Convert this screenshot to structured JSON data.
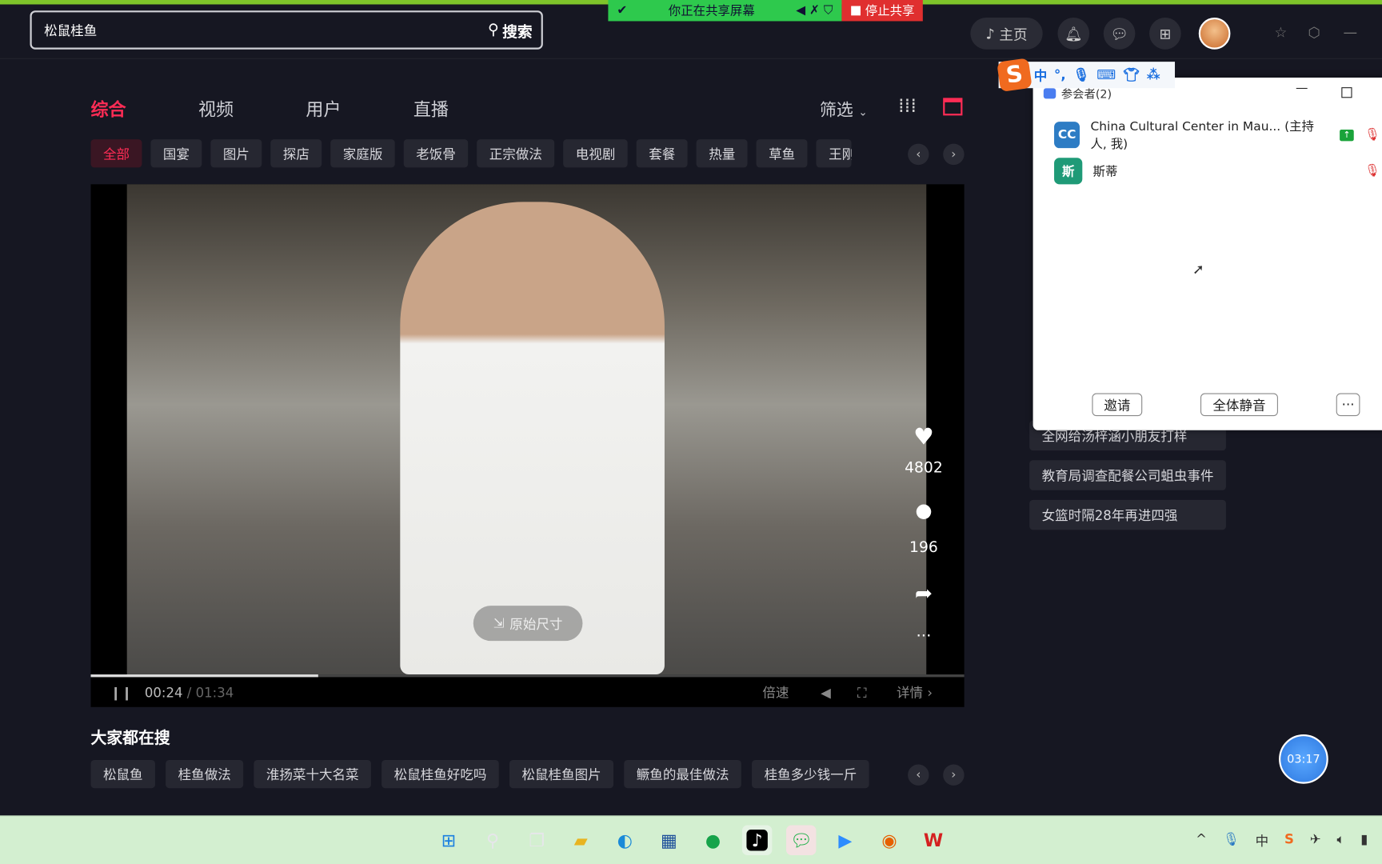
{
  "search": {
    "value": "松鼠桂鱼",
    "button": "搜索"
  },
  "share_bar": {
    "status": "你正在共享屏幕",
    "stop": "停止共享"
  },
  "header": {
    "home": "主页"
  },
  "tabs": [
    {
      "label": "综合",
      "active": true
    },
    {
      "label": "视频"
    },
    {
      "label": "用户"
    },
    {
      "label": "直播"
    }
  ],
  "filter": "筛选",
  "chips": [
    "全部",
    "国宴",
    "图片",
    "探店",
    "家庭版",
    "老饭骨",
    "正宗做法",
    "电视剧",
    "套餐",
    "热量",
    "草鱼",
    "王刚"
  ],
  "video": {
    "likes": "4802",
    "comments": "196",
    "original_size": "原始尺寸",
    "time_current": "00:24",
    "time_total": "01:34",
    "progress": 0.26,
    "speed": "倍速",
    "details": "详情"
  },
  "hot": {
    "title": "大家都在搜",
    "items": [
      "松鼠鱼",
      "桂鱼做法",
      "淮扬菜十大名菜",
      "松鼠桂鱼好吃吗",
      "松鼠桂鱼图片",
      "鳜鱼的最佳做法",
      "桂鱼多少钱一斤"
    ]
  },
  "right_list": [
    "全网给汤梓涵小朋友打样",
    "教育局调查配餐公司蛆虫事件",
    "女篮时隔28年再进四强"
  ],
  "zoom_panel": {
    "title": "参会者(2)",
    "participants": [
      {
        "initials": "CC",
        "name": "China Cultural Center in Mau... (主持人, 我)",
        "color": "#2d7cc4"
      },
      {
        "initials": "斯",
        "name": "斯蒂",
        "color": "#1f9a77"
      }
    ],
    "invite": "邀请",
    "mute_all": "全体静音",
    "more": "···"
  },
  "ime": {
    "mode": "中"
  },
  "timer": "03:17",
  "colors": {
    "accent": "#fe2c55",
    "share_green": "#2ec94d",
    "stop_red": "#e02f2f"
  }
}
